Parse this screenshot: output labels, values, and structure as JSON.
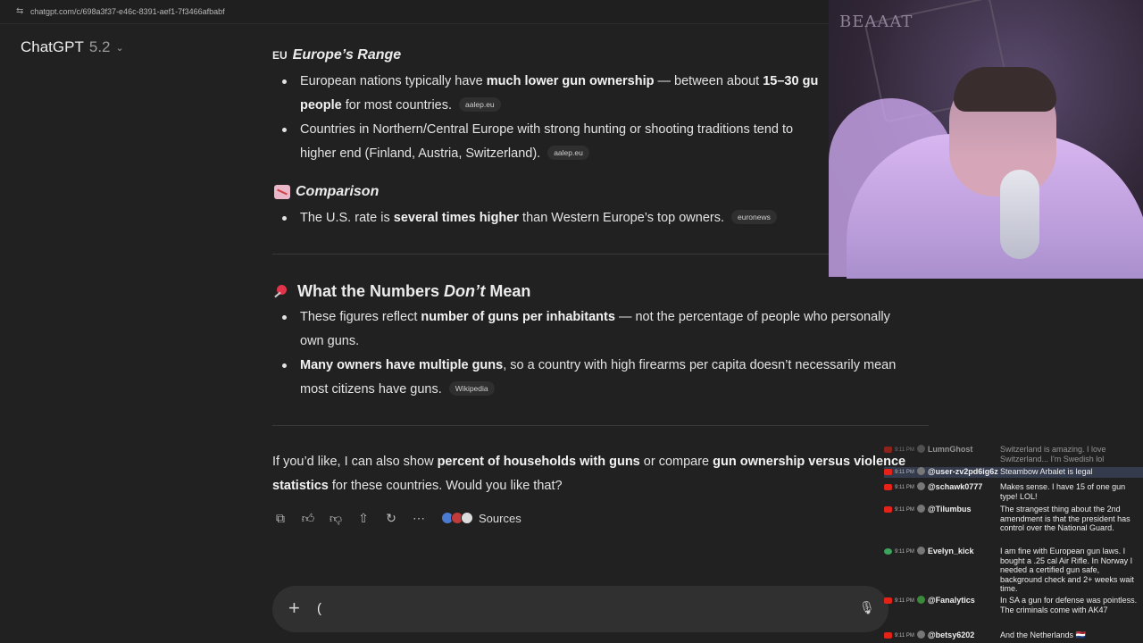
{
  "browser": {
    "url": "chatgpt.com/c/698a3f37-e46c-8391-aef1-7f3466afbabf"
  },
  "header": {
    "model_name": "ChatGPT",
    "model_version": "5.2"
  },
  "europe": {
    "flag": "EU",
    "heading": "Europe’s Range",
    "items": [
      {
        "pre": "European nations typically have ",
        "bold": "much lower gun ownership",
        "mid": " — between about ",
        "bold2": "15–30 gu",
        "line2_bold": "people",
        "post": " for most countries.",
        "cite": "aalep.eu"
      },
      {
        "text": "Countries in Northern/Central Europe with strong hunting or shooting traditions tend to",
        "line2": "higher end (Finland, Austria, Switzerland).",
        "cite": "aalep.eu"
      }
    ]
  },
  "comparison": {
    "heading": "Comparison",
    "items": [
      {
        "pre": "The U.S. rate is ",
        "bold": "several times higher",
        "post": " than Western Europe’s top owners.",
        "cite": "euronews"
      }
    ]
  },
  "numbers": {
    "heading_pre": "What the Numbers ",
    "heading_em": "Don’t",
    "heading_post": " Mean",
    "items": [
      {
        "pre": "These figures reflect ",
        "bold": "number of guns per inhabitants",
        "post": " — not the percentage of people who personally",
        "line2": "own guns."
      },
      {
        "bold": "Many owners have multiple guns",
        "post": ", so a country with high firearms per capita doesn’t necessarily mean",
        "line2": "most citizens have guns.",
        "cite": "Wikipedia"
      }
    ]
  },
  "followup": {
    "pre": "If you’d like, I can also show ",
    "bold1": "percent of households with guns",
    "mid": " or compare ",
    "bold2": "gun ownership versus violence",
    "line2_bold": "statistics",
    "line2_post": " for these countries. Would you like that?"
  },
  "actions": {
    "sources_label": "Sources",
    "icons": [
      "copy-icon",
      "thumbs-up-icon",
      "thumbs-down-icon",
      "share-icon",
      "regenerate-icon",
      "more-icon"
    ]
  },
  "composer": {
    "value": "("
  },
  "webcam": {
    "sign_text": "BEAAAT"
  },
  "chat": [
    {
      "time": "9:11 PM",
      "user": "LumnGhost",
      "msg": "Switzerland is amazing. I love Switzerland... I'm Swedish lol",
      "platform": "youtube"
    },
    {
      "time": "9:11 PM",
      "user": "@user-zv2pd6ig6z",
      "msg": "Steambow Arbalet is legal",
      "platform": "youtube"
    },
    {
      "time": "9:11 PM",
      "user": "@schawk0777",
      "msg": "Makes sense. I have 15 of one gun type! LOL!",
      "platform": "youtube"
    },
    {
      "time": "9:11 PM",
      "user": "@Tilumbus",
      "msg": "The strangest thing about the 2nd amendment is that the president has control over the National Guard.",
      "platform": "youtube"
    },
    {
      "time": "9:11 PM",
      "user": "Evelyn_kick",
      "msg": "I am fine with European gun laws. I bought a .25 cal Air Rifle. In Norway I needed a certified gun safe, background check and 2+ weeks wait time.",
      "platform": "kick"
    },
    {
      "time": "9:11 PM",
      "user": "@Fanalytics",
      "msg": "In SA a gun for defense was pointless. The criminals come with AK47",
      "platform": "youtube"
    },
    {
      "time": "9:11 PM",
      "user": "@betsy6202",
      "msg": "And the Netherlands 🇳🇱",
      "platform": "youtube"
    }
  ]
}
